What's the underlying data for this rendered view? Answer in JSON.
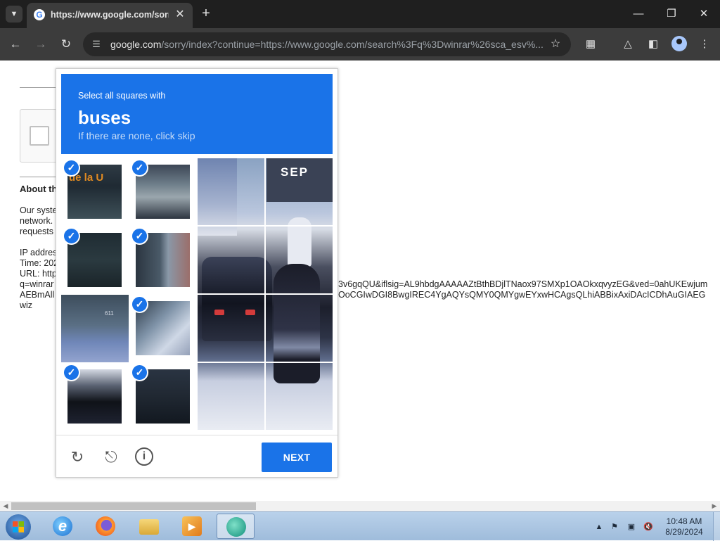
{
  "browser": {
    "tab_title": "https://www.google.com/sorry/index?",
    "url_host": "google.com",
    "url_path": "/sorry/index?continue=https://www.google.com/search%3Fq%3Dwinrar%26sca_esv%...",
    "icons": [
      "tab-search-icon",
      "google-favicon",
      "close-icon",
      "plus-icon",
      "minimize-icon",
      "maximize-icon",
      "close-window-icon",
      "back-icon",
      "forward-icon",
      "reload-icon",
      "site-info-icon",
      "star-icon",
      "extensions-icon",
      "labs-icon",
      "side-panel-icon",
      "profile-icon",
      "menu-icon"
    ]
  },
  "page": {
    "about_title": "About th",
    "body_lines": [
      "Our syste",
      "network.",
      "requests"
    ],
    "ip_label": "IP addres",
    "time_label": "Time: 202",
    "url_label": "URL: http",
    "q_label": "q=winrar",
    "aeb_label": "AEBmAll",
    "wiz_label": "wiz",
    "url_tail_1": "3v6gqQU&iflsig=AL9hbdgAAAAAZtBthBDjlTNaox97SMXp1OAOkxqvyzEG&ved=0ahUKEwjum",
    "url_tail_2": "OoCGIwDGI8BwgIREC4YgAQYsQMY0QMYgwEYxwHCAgsQLhiABBixAxiDAcICDhAuGIAEG"
  },
  "captcha": {
    "instruction": "Select all squares with",
    "target": "buses",
    "hint": "If there are none, click skip",
    "bus_sign_text": "ue la U",
    "sign_text": "SEP",
    "bus_number": "611",
    "next_label": "NEXT",
    "tiles_selected": [
      true,
      true,
      true,
      true,
      false,
      true,
      true,
      true
    ],
    "footer_icons": [
      "reload-icon",
      "audio-icon",
      "info-icon"
    ]
  },
  "taskbar": {
    "apps": [
      "internet-explorer-icon",
      "firefox-icon",
      "file-explorer-icon",
      "media-player-icon",
      "app-icon"
    ],
    "time": "10:48 AM",
    "date": "8/29/2024"
  }
}
